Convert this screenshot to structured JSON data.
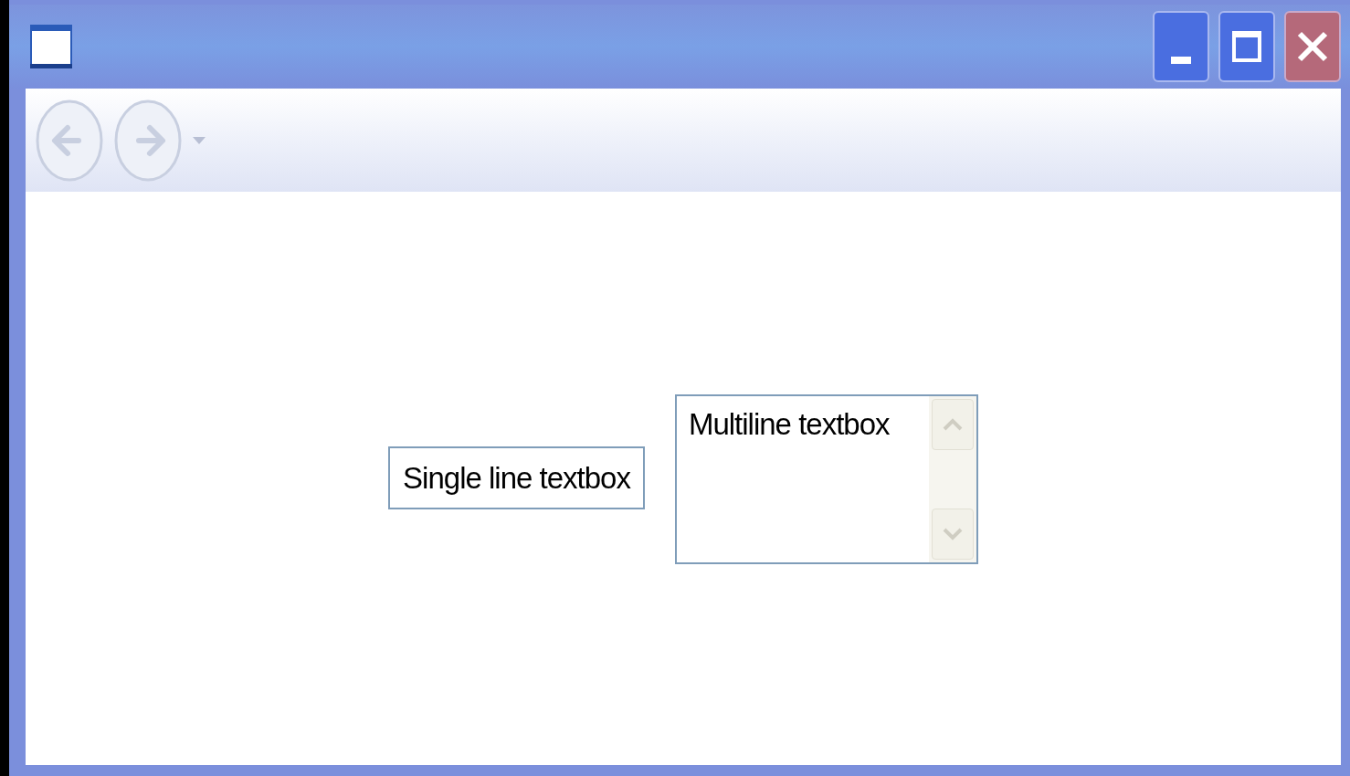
{
  "navigation": {
    "back": {
      "disabled": true
    },
    "forward": {
      "disabled": true
    }
  },
  "single_line_textbox": {
    "value": "Single line textbox"
  },
  "multiline_textbox": {
    "value": "Multiline textbox"
  }
}
